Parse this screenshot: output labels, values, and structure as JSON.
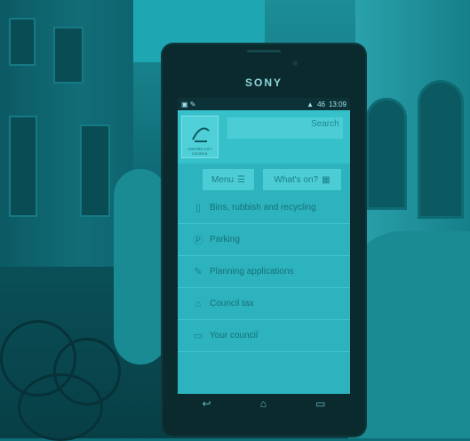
{
  "device": {
    "brand": "SONY"
  },
  "status_bar": {
    "time": "13:09",
    "battery": "46"
  },
  "header": {
    "logo_text": "OXFORD CITY COUNCIL",
    "search": {
      "placeholder": "",
      "button_label": "Search"
    }
  },
  "nav": {
    "menu_label": "Menu",
    "whats_on_label": "What's on?"
  },
  "services": [
    {
      "label": "Bins, rubbish and recycling",
      "icon": "bin-icon"
    },
    {
      "label": "Parking",
      "icon": "parking-icon"
    },
    {
      "label": "Planning applications",
      "icon": "planning-icon"
    },
    {
      "label": "Council tax",
      "icon": "council-tax-icon"
    },
    {
      "label": "Your council",
      "icon": "your-council-icon"
    }
  ],
  "colors": {
    "screen_bg": "#2cb3bd",
    "tint": "#0f6f79"
  }
}
